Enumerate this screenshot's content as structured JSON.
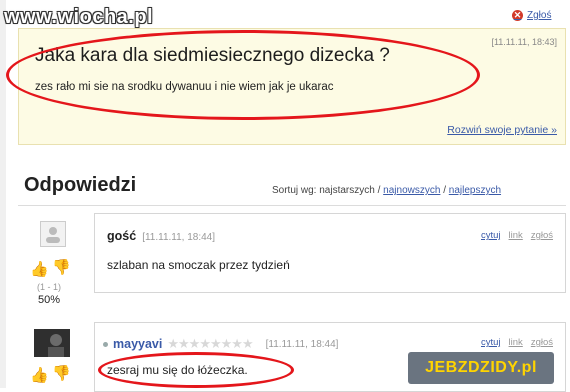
{
  "watermark": "www.wiocha.pl",
  "top_report": "Zgłoś",
  "question": {
    "date": "[11.11.11, 18:43]",
    "title": "Jaka kara dla siedmiesiecznego dizecka ?",
    "body": "zes rało mi sie na srodku dywanuu i nie wiem jak je ukarac",
    "expand": "Rozwiń swoje pytanie »"
  },
  "answers_section": {
    "title": "Odpowiedzi",
    "sort_prefix": "Sortuj wg: najstarszych /",
    "sort_newest": "najnowszych",
    "sort_sep": "/",
    "sort_best": "najlepszych"
  },
  "answers": [
    {
      "author": "gość",
      "date": "[11.11.11, 18:44]",
      "quote": "cytuj",
      "link": "link",
      "report": "zgłoś",
      "text": "szlaban na smoczak przez tydzień",
      "votes": "(1 - 1)",
      "percent": "50%"
    },
    {
      "author": "mayyavi",
      "date": "[11.11.11, 18:44]",
      "quote": "cytuj",
      "link": "link",
      "report": "zgłoś",
      "text": "zesraj mu się do łóżeczka.",
      "rating_stars": 0
    }
  ],
  "bottom_logo": "JEBZDZIDY.pl",
  "colors": {
    "accent_link": "#3a5aa8",
    "highlight_red": "#e4161b",
    "question_bg": "#fdfbe4"
  }
}
